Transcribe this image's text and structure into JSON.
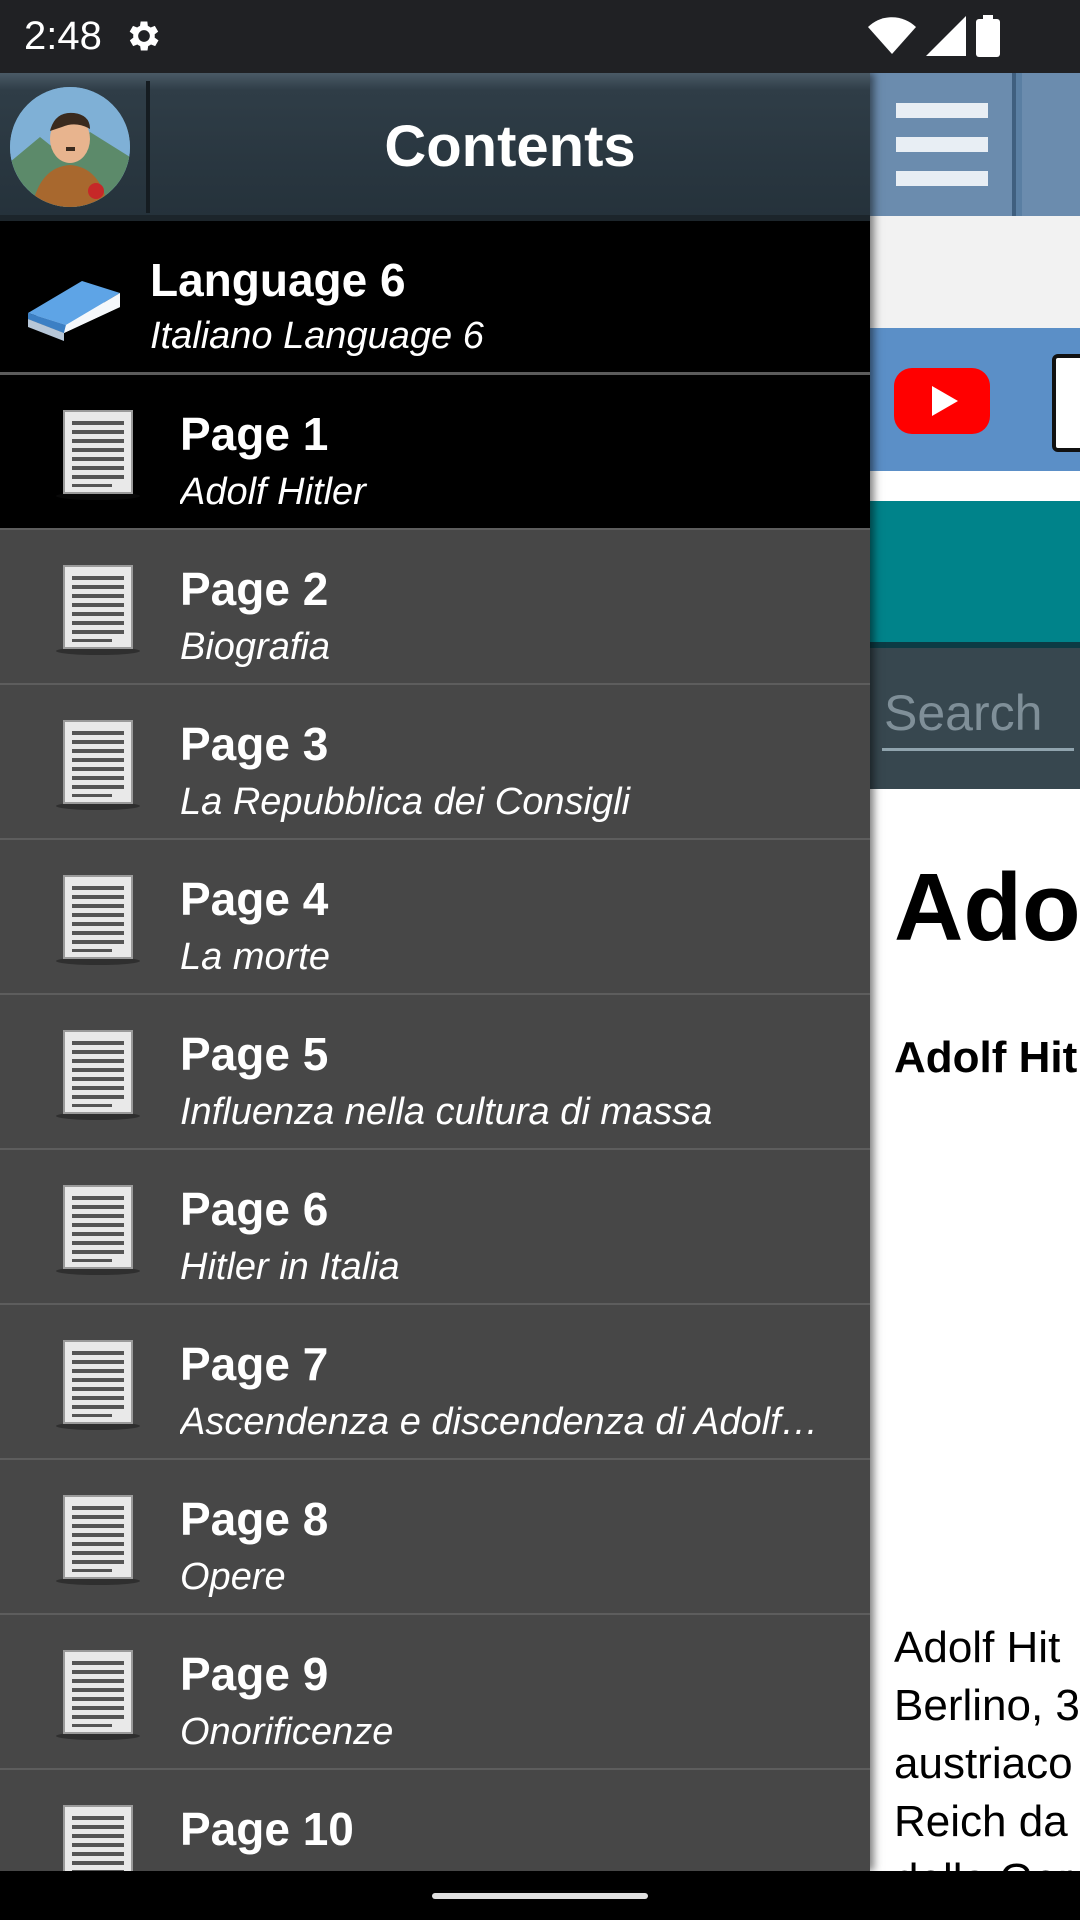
{
  "status_bar": {
    "time": "2:48",
    "icons": [
      "gear-icon",
      "wifi-icon",
      "signal-icon",
      "battery-icon"
    ]
  },
  "main_page": {
    "search_placeholder": "Search",
    "heading": "Adol",
    "subheading": "Adolf Hit",
    "body_lines": [
      "Adolf Hit",
      "Berlino, 3",
      "austriaco",
      "Reich da",
      "della Ger"
    ],
    "icons": [
      "menu-icon",
      "youtube-icon",
      "document-icon"
    ],
    "colors": {
      "toolbar": "#5a7fa3",
      "icon_row": "#5b8fc7",
      "teal_bar": "#00838a",
      "search_bar": "#37474f"
    }
  },
  "drawer": {
    "title": "Contents",
    "avatar_icon": "avatar-portrait",
    "book": {
      "title": "Language 6",
      "subtitle": "Italiano Language 6",
      "icon": "book-icon"
    },
    "pages": [
      {
        "title": "Page 1",
        "subtitle": "Adolf Hitler",
        "selected": true
      },
      {
        "title": "Page 2",
        "subtitle": "Biografia"
      },
      {
        "title": "Page 3",
        "subtitle": "La Repubblica dei Consigli"
      },
      {
        "title": "Page 4",
        "subtitle": "La morte"
      },
      {
        "title": "Page 5",
        "subtitle": "Influenza nella cultura di massa"
      },
      {
        "title": "Page 6",
        "subtitle": "Hitler in Italia"
      },
      {
        "title": "Page 7",
        "subtitle": "Ascendenza e discendenza di Adolf…"
      },
      {
        "title": "Page 8",
        "subtitle": "Opere"
      },
      {
        "title": "Page 9",
        "subtitle": "Onorificenze"
      },
      {
        "title": "Page 10",
        "subtitle": ""
      }
    ],
    "colors": {
      "background": "#474747",
      "selected": "#000000",
      "header": "#25323b"
    }
  }
}
